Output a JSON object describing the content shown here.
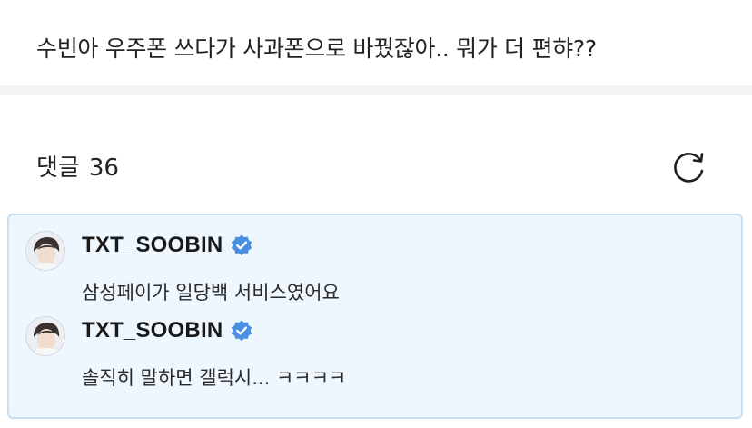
{
  "post": {
    "title": "수빈아 우주폰 쓰다가 사과폰으로 바꿨잖아.. 뭐가 더 편햐??"
  },
  "comments": {
    "label": "댓글",
    "count": "36",
    "refresh_icon": "refresh-icon"
  },
  "replies": [
    {
      "author": "TXT_SOOBIN",
      "verified_icon": "verified-badge-icon",
      "text": "삼성페이가 일당백 서비스였어요"
    },
    {
      "author": "TXT_SOOBIN",
      "verified_icon": "verified-badge-icon",
      "text": "솔직히 말하면 갤럭시... ㅋㅋㅋㅋ"
    }
  ],
  "colors": {
    "highlight_bg": "#eef7fd",
    "highlight_border": "#c6e0ef",
    "verified_blue": "#4a90e2"
  }
}
